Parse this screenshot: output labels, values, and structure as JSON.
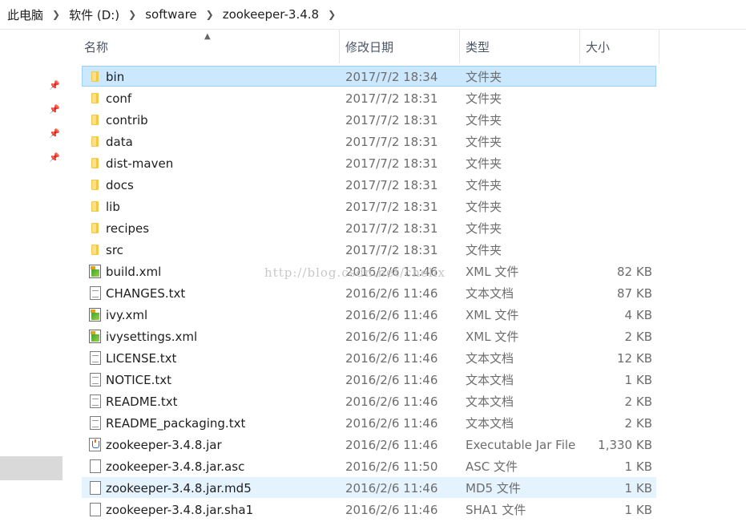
{
  "breadcrumb": {
    "items": [
      "此电脑",
      "软件 (D:)",
      "software",
      "zookeeper-3.4.8"
    ]
  },
  "columns": {
    "name": "名称",
    "modified": "修改日期",
    "type": "类型",
    "size": "大小"
  },
  "watermark": "http://blog.csdn.net/chellx",
  "colors": {
    "selected_bg": "#cce8ff",
    "hover_bg": "#e5f3ff",
    "folder": "#f3c846"
  },
  "files": [
    {
      "name": "bin",
      "modified": "2017/7/2 18:34",
      "type": "文件夹",
      "size": "",
      "icon": "folder-icon"
    },
    {
      "name": "conf",
      "modified": "2017/7/2 18:31",
      "type": "文件夹",
      "size": "",
      "icon": "folder-icon"
    },
    {
      "name": "contrib",
      "modified": "2017/7/2 18:31",
      "type": "文件夹",
      "size": "",
      "icon": "folder-icon"
    },
    {
      "name": "data",
      "modified": "2017/7/2 18:31",
      "type": "文件夹",
      "size": "",
      "icon": "folder-icon"
    },
    {
      "name": "dist-maven",
      "modified": "2017/7/2 18:31",
      "type": "文件夹",
      "size": "",
      "icon": "folder-icon"
    },
    {
      "name": "docs",
      "modified": "2017/7/2 18:31",
      "type": "文件夹",
      "size": "",
      "icon": "folder-icon"
    },
    {
      "name": "lib",
      "modified": "2017/7/2 18:31",
      "type": "文件夹",
      "size": "",
      "icon": "folder-icon"
    },
    {
      "name": "recipes",
      "modified": "2017/7/2 18:31",
      "type": "文件夹",
      "size": "",
      "icon": "folder-icon"
    },
    {
      "name": "src",
      "modified": "2017/7/2 18:31",
      "type": "文件夹",
      "size": "",
      "icon": "folder-icon"
    },
    {
      "name": "build.xml",
      "modified": "2016/2/6 11:46",
      "type": "XML 文件",
      "size": "82 KB",
      "icon": "xml-file-icon"
    },
    {
      "name": "CHANGES.txt",
      "modified": "2016/2/6 11:46",
      "type": "文本文档",
      "size": "87 KB",
      "icon": "text-document-icon"
    },
    {
      "name": "ivy.xml",
      "modified": "2016/2/6 11:46",
      "type": "XML 文件",
      "size": "4 KB",
      "icon": "xml-file-icon"
    },
    {
      "name": "ivysettings.xml",
      "modified": "2016/2/6 11:46",
      "type": "XML 文件",
      "size": "2 KB",
      "icon": "xml-file-icon"
    },
    {
      "name": "LICENSE.txt",
      "modified": "2016/2/6 11:46",
      "type": "文本文档",
      "size": "12 KB",
      "icon": "text-document-icon"
    },
    {
      "name": "NOTICE.txt",
      "modified": "2016/2/6 11:46",
      "type": "文本文档",
      "size": "1 KB",
      "icon": "text-document-icon"
    },
    {
      "name": "README.txt",
      "modified": "2016/2/6 11:46",
      "type": "文本文档",
      "size": "2 KB",
      "icon": "text-document-icon"
    },
    {
      "name": "README_packaging.txt",
      "modified": "2016/2/6 11:46",
      "type": "文本文档",
      "size": "2 KB",
      "icon": "text-document-icon"
    },
    {
      "name": "zookeeper-3.4.8.jar",
      "modified": "2016/2/6 11:46",
      "type": "Executable Jar File",
      "size": "1,330 KB",
      "icon": "jar-file-icon"
    },
    {
      "name": "zookeeper-3.4.8.jar.asc",
      "modified": "2016/2/6 11:50",
      "type": "ASC 文件",
      "size": "1 KB",
      "icon": "blank-file-icon"
    },
    {
      "name": "zookeeper-3.4.8.jar.md5",
      "modified": "2016/2/6 11:46",
      "type": "MD5 文件",
      "size": "1 KB",
      "icon": "blank-file-icon"
    },
    {
      "name": "zookeeper-3.4.8.jar.sha1",
      "modified": "2016/2/6 11:46",
      "type": "SHA1 文件",
      "size": "1 KB",
      "icon": "blank-file-icon"
    }
  ]
}
